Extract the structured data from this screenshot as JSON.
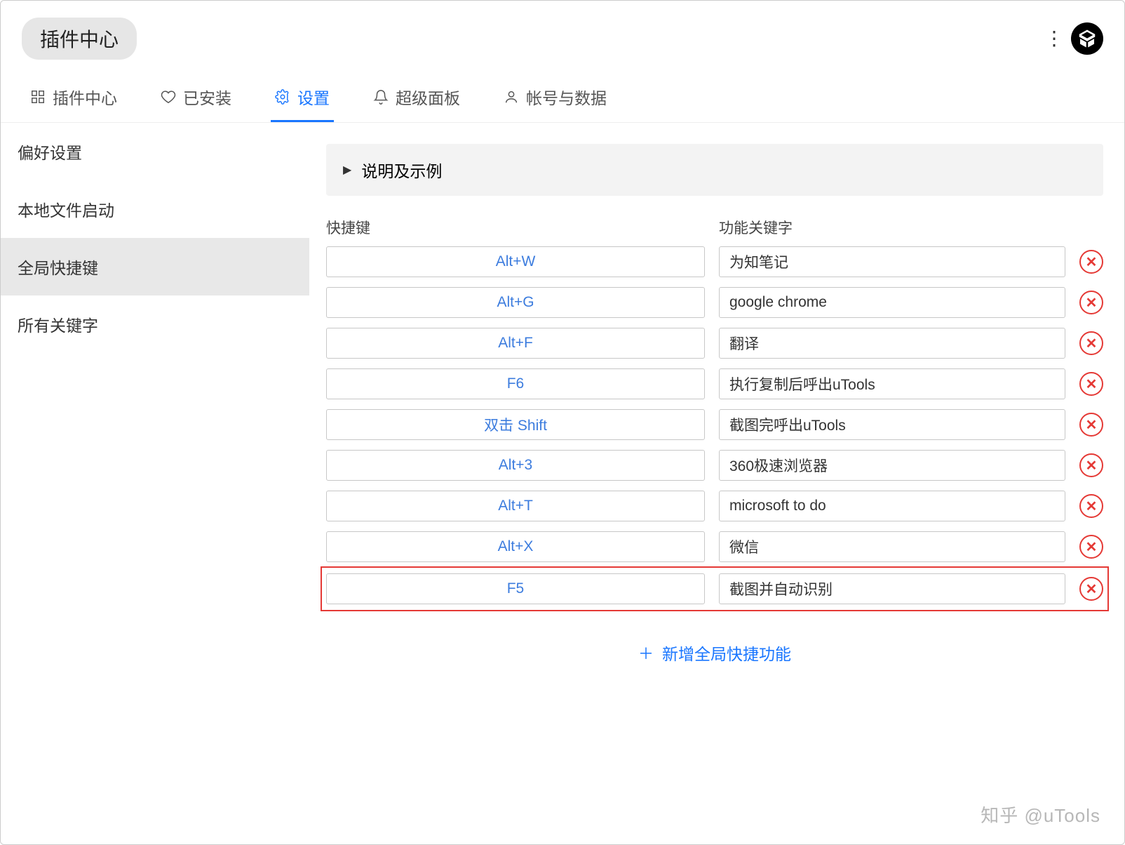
{
  "header": {
    "title": "插件中心"
  },
  "tabs": [
    {
      "label": "插件中心",
      "icon": "apps"
    },
    {
      "label": "已安装",
      "icon": "heart"
    },
    {
      "label": "设置",
      "icon": "gear",
      "active": true
    },
    {
      "label": "超级面板",
      "icon": "bell"
    },
    {
      "label": "帐号与数据",
      "icon": "user"
    }
  ],
  "sidebar": {
    "items": [
      {
        "label": "偏好设置"
      },
      {
        "label": "本地文件启动"
      },
      {
        "label": "全局快捷键",
        "active": true
      },
      {
        "label": "所有关键字"
      }
    ]
  },
  "panel": {
    "explain_label": "说明及示例",
    "col_shortcut": "快捷键",
    "col_keyword": "功能关键字",
    "rows": [
      {
        "key": "Alt+W",
        "val": "为知笔记"
      },
      {
        "key": "Alt+G",
        "val": "google chrome"
      },
      {
        "key": "Alt+F",
        "val": "翻译"
      },
      {
        "key": "F6",
        "val": "执行复制后呼出uTools"
      },
      {
        "key": "双击 Shift",
        "val": "截图完呼出uTools"
      },
      {
        "key": "Alt+3",
        "val": "360极速浏览器"
      },
      {
        "key": "Alt+T",
        "val": "microsoft to do"
      },
      {
        "key": "Alt+X",
        "val": "微信"
      },
      {
        "key": "F5",
        "val": "截图并自动识别",
        "highlight": true
      }
    ],
    "add_label": "新增全局快捷功能"
  },
  "watermark": "知乎 @uTools"
}
